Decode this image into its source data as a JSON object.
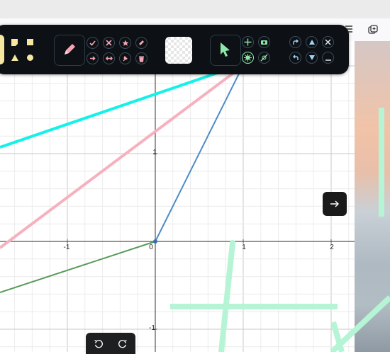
{
  "browser": {
    "collections_icon": "collections-icon",
    "menu_icon": "reading-list-icon"
  },
  "graph": {
    "x_ticks": [
      "-1",
      "0",
      "1",
      "2"
    ],
    "y_ticks": [
      "1",
      "-1"
    ],
    "lines": [
      {
        "name": "cyan",
        "color": "#12f2e8"
      },
      {
        "name": "pink",
        "color": "#f6b1bf"
      },
      {
        "name": "blue",
        "color": "#4c8cc8"
      },
      {
        "name": "green",
        "color": "#579a5a"
      }
    ]
  },
  "toolbar": {
    "shapes": [
      "rounded-square-icon",
      "square-icon",
      "triangle-icon",
      "circle-icon"
    ],
    "pen": "pencil-icon",
    "edit_tools": [
      "check-icon",
      "x-icon",
      "star-icon",
      "eraser-icon",
      "arrow-right-icon",
      "double-arrow-icon",
      "pin-icon",
      "trash-icon"
    ],
    "color_swatch": "transparent",
    "select": "cursor-icon",
    "view_tools": [
      "move-icon",
      "camera-icon",
      "burst-icon",
      "slash-icon"
    ],
    "nav_tools": [
      "redo-icon",
      "up-icon",
      "close-icon",
      "undo-icon",
      "down-icon",
      "underscore-icon"
    ]
  },
  "fab": {
    "icon": "arrow-right-icon"
  },
  "undo_bar": {
    "undo": "undo-icon",
    "redo": "redo-icon"
  },
  "accent_color": "#b5f5d5"
}
